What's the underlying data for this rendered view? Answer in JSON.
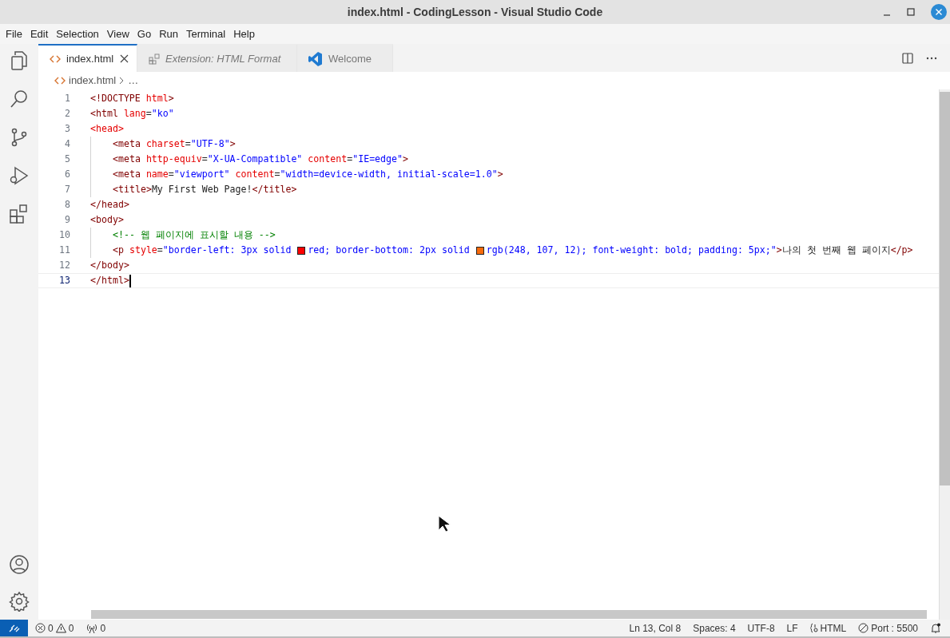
{
  "window": {
    "title": "index.html - CodingLesson - Visual Studio Code"
  },
  "menu": [
    "File",
    "Edit",
    "Selection",
    "View",
    "Go",
    "Run",
    "Terminal",
    "Help"
  ],
  "tabs": [
    {
      "label": "index.html",
      "kind": "file",
      "selected": true,
      "preview": false
    },
    {
      "label": "Extension: HTML Format",
      "kind": "extension",
      "selected": false,
      "preview": true
    },
    {
      "label": "Welcome",
      "kind": "welcome",
      "selected": false,
      "preview": false
    }
  ],
  "breadcrumb": [
    "index.html",
    "…"
  ],
  "editor": {
    "lines": [
      {
        "number": "1",
        "current": false,
        "tokens": [
          {
            "kind": "tag",
            "text": "<!DOCTYPE "
          },
          {
            "kind": "attr",
            "text": "html"
          },
          {
            "kind": "tag",
            "text": ">"
          }
        ]
      },
      {
        "number": "2",
        "current": false,
        "tokens": [
          {
            "kind": "tag",
            "text": "<html "
          },
          {
            "kind": "attr",
            "text": "lang"
          },
          {
            "kind": "plain",
            "text": "="
          },
          {
            "kind": "str",
            "text": "\"ko\""
          }
        ]
      },
      {
        "number": "3",
        "current": false,
        "tokens": [
          {
            "kind": "attr",
            "text": "<head>"
          }
        ],
        "children": [
          {
            "number": "4",
            "current": false,
            "tokens": [
              {
                "kind": "tag",
                "text": "<meta "
              },
              {
                "kind": "attr",
                "text": "charset"
              },
              {
                "kind": "plain",
                "text": "="
              },
              {
                "kind": "str",
                "text": "\"UTF-8\""
              },
              {
                "kind": "tag",
                "text": ">"
              }
            ]
          },
          {
            "number": "5",
            "current": false,
            "tokens": [
              {
                "kind": "tag",
                "text": "<meta "
              },
              {
                "kind": "attr",
                "text": "http-equiv"
              },
              {
                "kind": "plain",
                "text": "="
              },
              {
                "kind": "str",
                "text": "\"X-UA-Compatible\" "
              },
              {
                "kind": "attr",
                "text": "content"
              },
              {
                "kind": "plain",
                "text": "="
              },
              {
                "kind": "str",
                "text": "\"IE=edge\""
              },
              {
                "kind": "tag",
                "text": ">"
              }
            ]
          },
          {
            "number": "6",
            "current": false,
            "tokens": [
              {
                "kind": "tag",
                "text": "<meta "
              },
              {
                "kind": "attr",
                "text": "name"
              },
              {
                "kind": "plain",
                "text": "="
              },
              {
                "kind": "str",
                "text": "\"viewport\" "
              },
              {
                "kind": "attr",
                "text": "content"
              },
              {
                "kind": "plain",
                "text": "="
              },
              {
                "kind": "str",
                "text": "\"width=device-width, initial-scale=1.0\""
              },
              {
                "kind": "tag",
                "text": ">"
              }
            ]
          },
          {
            "number": "7",
            "current": false,
            "tokens": [
              {
                "kind": "tag",
                "text": "<title>"
              },
              {
                "kind": "plain",
                "text": "My First Web Page!"
              },
              {
                "kind": "tag",
                "text": "</title>"
              }
            ]
          }
        ]
      },
      {
        "number": "8",
        "current": false,
        "tokens": [
          {
            "kind": "tag",
            "text": "</head>"
          }
        ]
      },
      {
        "number": "9",
        "current": false,
        "tokens": [
          {
            "kind": "tag",
            "text": "<body>"
          }
        ],
        "children": [
          {
            "number": "10",
            "current": false,
            "tokens": [
              {
                "kind": "comment",
                "text": "<!-- 웹 페이지에 표시할 내용 -->"
              }
            ]
          },
          {
            "number": "11",
            "current": false,
            "tokens": [
              {
                "kind": "tag",
                "text": "<p "
              },
              {
                "kind": "attr",
                "text": "style"
              },
              {
                "kind": "plain",
                "text": "="
              },
              {
                "kind": "str",
                "text": "\"border-left: 3px solid "
              },
              {
                "kind": "swatch",
                "color": "#ff0000"
              },
              {
                "kind": "str",
                "text": "red; border-bottom: 2px solid "
              },
              {
                "kind": "swatch",
                "color": "#f86b0c"
              },
              {
                "kind": "str",
                "text": "rgb(248, 107, 12); font-weight: bold; padding: 5px;\""
              },
              {
                "kind": "tag",
                "text": ">"
              },
              {
                "kind": "plain",
                "text": "나의 첫 번째 웹 페이지"
              },
              {
                "kind": "tag",
                "text": "</p>"
              }
            ]
          }
        ]
      },
      {
        "number": "12",
        "current": false,
        "tokens": [
          {
            "kind": "tag",
            "text": "</body>"
          }
        ]
      },
      {
        "number": "13",
        "current": true,
        "tokens": [
          {
            "kind": "tag",
            "text": "</html>"
          }
        ]
      }
    ]
  },
  "status_bar": {
    "errors": "0",
    "warnings": "0",
    "ports": "0",
    "position": "Ln 13, Col 8",
    "spaces": "Spaces: 4",
    "encoding": "UTF-8",
    "eol": "LF",
    "language": "HTML",
    "live_server": "Port : 5500"
  }
}
